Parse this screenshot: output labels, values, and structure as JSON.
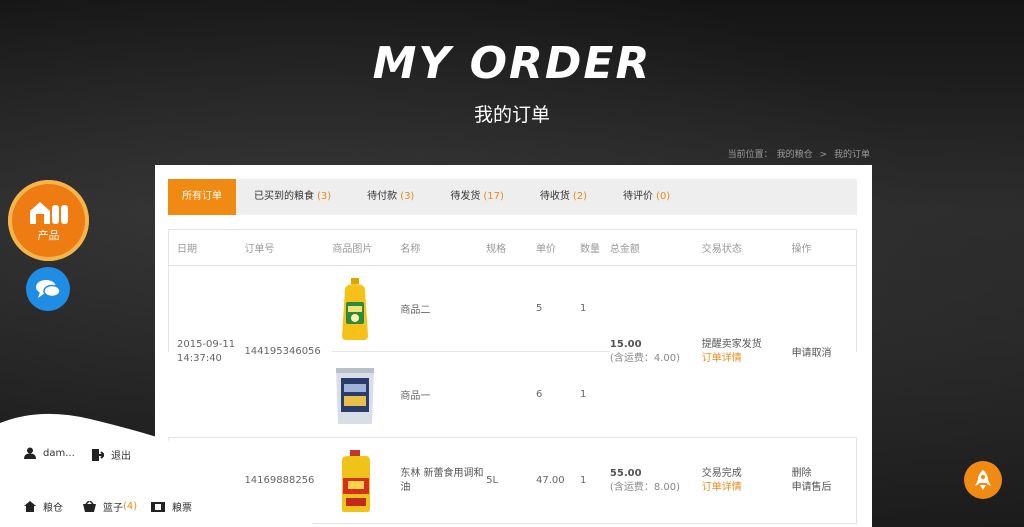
{
  "header": {
    "title": "MY ORDER",
    "subtitle": "我的订单"
  },
  "breadcrumb": {
    "prefix": "当前位置：",
    "items": [
      "我的粮仓",
      "我的订单"
    ],
    "separator": ">"
  },
  "tabs": [
    {
      "label": "所有订单",
      "count": null,
      "active": true
    },
    {
      "label": "已买到的粮食",
      "count": "(3)"
    },
    {
      "label": "待付款",
      "count": "(3)"
    },
    {
      "label": "待发货",
      "count": "(17)"
    },
    {
      "label": "待收货",
      "count": "(2)"
    },
    {
      "label": "待评价",
      "count": "(0)"
    }
  ],
  "table": {
    "headers": [
      "日期",
      "订单号",
      "商品图片",
      "名称",
      "规格",
      "单价",
      "数量",
      "总金额",
      "交易状态",
      "操作"
    ],
    "orders": [
      {
        "date": "2015-09-11",
        "time": "14:37:40",
        "order_no": "144195346056",
        "items": [
          {
            "image": "oil-bottle",
            "name": "商品二",
            "spec": "",
            "price": "5",
            "qty": "1"
          },
          {
            "image": "rice-bag",
            "name": "商品一",
            "spec": "",
            "price": "6",
            "qty": "1"
          }
        ],
        "total": "15.00",
        "shipping": "(含运费：4.00)",
        "status": "提醒卖家发货",
        "detail_link": "订单详情",
        "actions": [
          "申请取消"
        ]
      },
      {
        "order_no_partial": "14169888256",
        "items": [
          {
            "image": "oil-jug",
            "name": "东林 新蕾食用调和油",
            "spec": "5L",
            "price": "47.00",
            "qty": "1"
          }
        ],
        "total": "55.00",
        "shipping": "(含运费：8.00)",
        "status": "交易完成",
        "detail_link": "订单详情",
        "actions": [
          "删除",
          "申请售后"
        ]
      }
    ]
  },
  "side": {
    "product_label": "产品"
  },
  "user_panel": {
    "username": "dam...",
    "logout": "退出",
    "granary": "粮仓",
    "basket_label": "篮子",
    "basket_count": "(4)",
    "tickets": "粮票"
  },
  "colors": {
    "accent": "#f08a12",
    "chat": "#1f8de3",
    "background": "#1c1c1c"
  }
}
